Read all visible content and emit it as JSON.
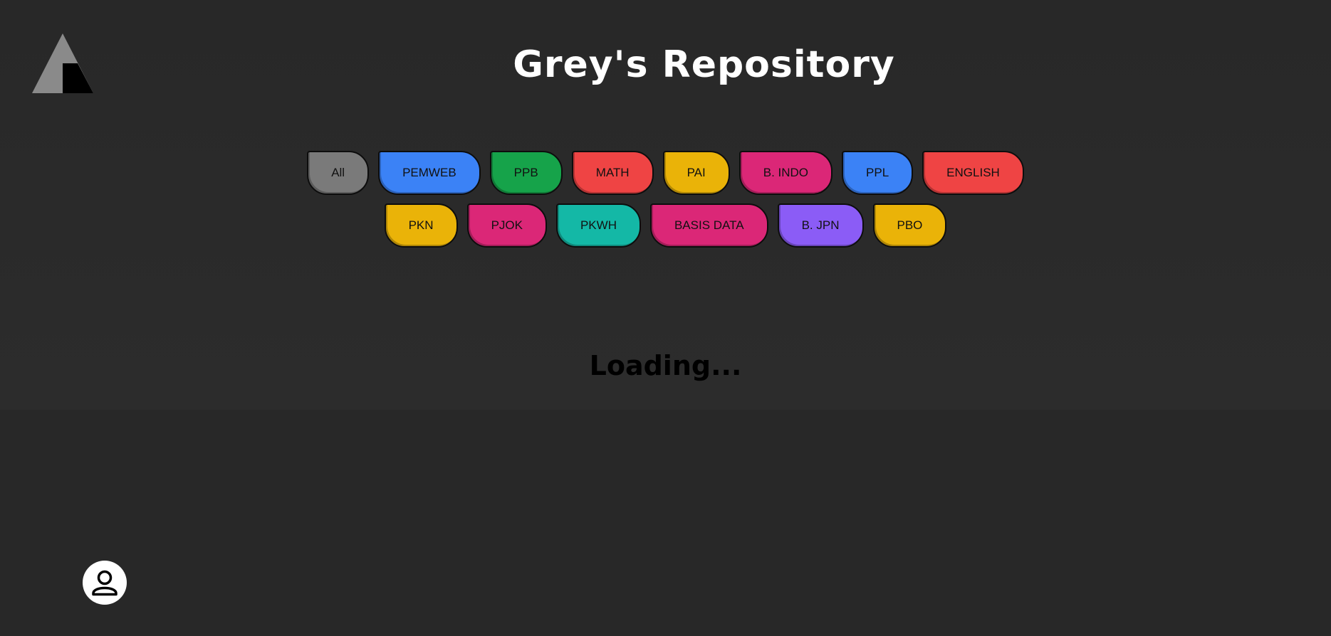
{
  "header": {
    "title": "Grey's Repository",
    "logo_icon": "triangle-logo-icon"
  },
  "filters": {
    "rows": [
      [
        {
          "label": "All",
          "color": "#7a7a7a"
        },
        {
          "label": "PEMWEB",
          "color": "#3b82f6"
        },
        {
          "label": "PPB",
          "color": "#16a34a"
        },
        {
          "label": "MATH",
          "color": "#ef4444"
        },
        {
          "label": "PAI",
          "color": "#eab308"
        },
        {
          "label": "B. INDO",
          "color": "#db2777"
        },
        {
          "label": "PPL",
          "color": "#3b82f6"
        },
        {
          "label": "ENGLISH",
          "color": "#ef4444"
        }
      ],
      [
        {
          "label": "PKN",
          "color": "#eab308"
        },
        {
          "label": "PJOK",
          "color": "#db2777"
        },
        {
          "label": "PKWH",
          "color": "#14b8a6"
        },
        {
          "label": "BASIS DATA",
          "color": "#db2777"
        },
        {
          "label": "B. JPN",
          "color": "#8b5cf6"
        },
        {
          "label": "PBO",
          "color": "#eab308"
        }
      ]
    ]
  },
  "content": {
    "status": "Loading..."
  },
  "profile": {
    "icon": "user-icon"
  }
}
